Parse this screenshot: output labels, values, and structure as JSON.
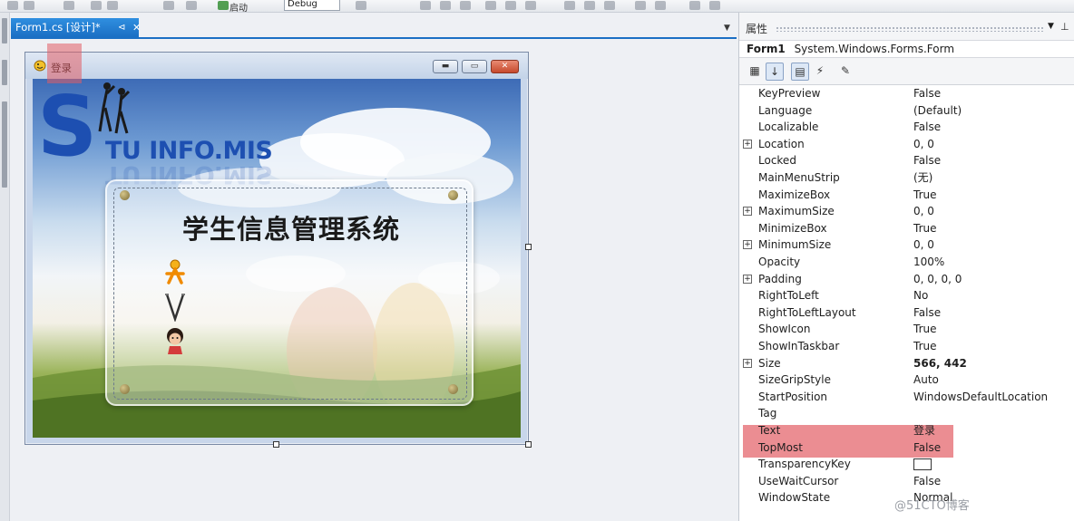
{
  "toolbar": {
    "start_label": "启动",
    "config_value": "Debug"
  },
  "document_tab": {
    "label": "Form1.cs [设计]*",
    "pin_glyph": "⊲",
    "close_glyph": "✕"
  },
  "form": {
    "title": "登录",
    "brand_text": "TU INFO.MIS",
    "brand_initial": "S",
    "system_title": "学生信息管理系统"
  },
  "properties": {
    "panel_title": "属性",
    "object_name": "Form1",
    "object_type": "System.Windows.Forms.Form",
    "rows": [
      {
        "name": "KeyPreview",
        "value": "False",
        "expandable": false
      },
      {
        "name": "Language",
        "value": "(Default)",
        "expandable": false
      },
      {
        "name": "Localizable",
        "value": "False",
        "expandable": false
      },
      {
        "name": "Location",
        "value": "0, 0",
        "expandable": true
      },
      {
        "name": "Locked",
        "value": "False",
        "expandable": false
      },
      {
        "name": "MainMenuStrip",
        "value": "(无)",
        "expandable": false
      },
      {
        "name": "MaximizeBox",
        "value": "True",
        "expandable": false
      },
      {
        "name": "MaximumSize",
        "value": "0, 0",
        "expandable": true
      },
      {
        "name": "MinimizeBox",
        "value": "True",
        "expandable": false
      },
      {
        "name": "MinimumSize",
        "value": "0, 0",
        "expandable": true
      },
      {
        "name": "Opacity",
        "value": "100%",
        "expandable": false
      },
      {
        "name": "Padding",
        "value": "0, 0, 0, 0",
        "expandable": true
      },
      {
        "name": "RightToLeft",
        "value": "No",
        "expandable": false
      },
      {
        "name": "RightToLeftLayout",
        "value": "False",
        "expandable": false
      },
      {
        "name": "ShowIcon",
        "value": "True",
        "expandable": false
      },
      {
        "name": "ShowInTaskbar",
        "value": "True",
        "expandable": false
      },
      {
        "name": "Size",
        "value": "566, 442",
        "expandable": true
      },
      {
        "name": "SizeGripStyle",
        "value": "Auto",
        "expandable": false
      },
      {
        "name": "StartPosition",
        "value": "WindowsDefaultLocation",
        "expandable": false
      },
      {
        "name": "Tag",
        "value": "",
        "expandable": false
      },
      {
        "name": "Text",
        "value": "登录",
        "expandable": false
      },
      {
        "name": "TopMost",
        "value": "False",
        "expandable": false
      },
      {
        "name": "TransparencyKey",
        "value": "",
        "expandable": false
      },
      {
        "name": "UseWaitCursor",
        "value": "False",
        "expandable": false
      },
      {
        "name": "WindowState",
        "value": "Normal",
        "expandable": false
      }
    ]
  },
  "watermark": "@51CTO博客",
  "colors": {
    "tab_active": "#1b6fc4",
    "highlight": "#e25c64",
    "brand_blue": "#1d4fb1"
  }
}
